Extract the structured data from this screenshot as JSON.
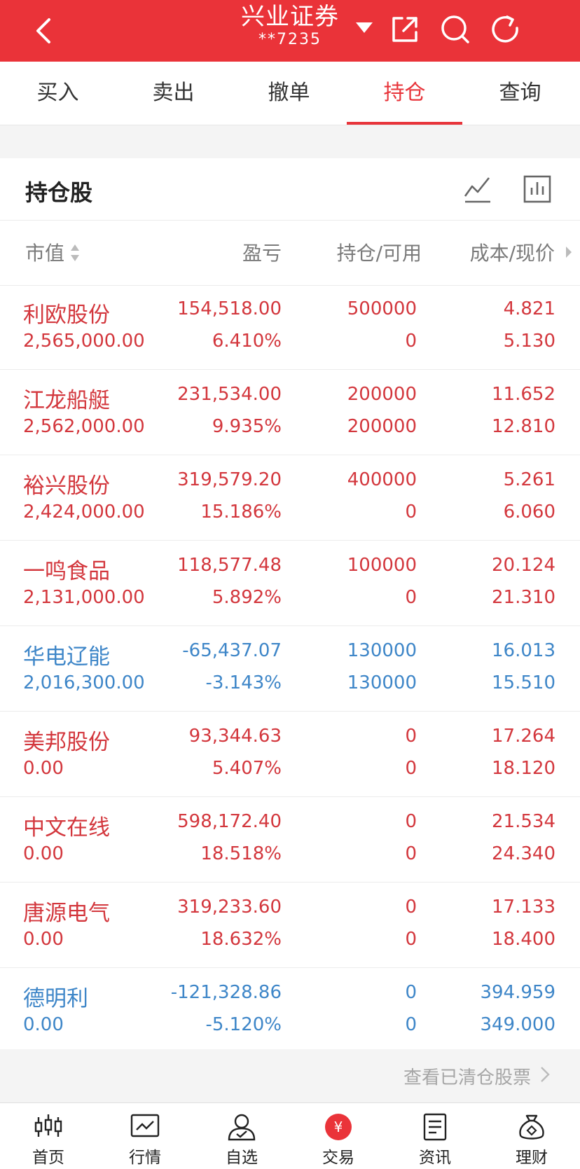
{
  "header": {
    "title": "兴业证券",
    "account": "**7235",
    "icons": [
      "back-icon",
      "dropdown-icon",
      "share-icon",
      "search-icon",
      "refresh-icon"
    ]
  },
  "tabs": [
    "买入",
    "卖出",
    "撤单",
    "持仓",
    "查询"
  ],
  "active_tab": "持仓",
  "section": {
    "title": "持仓股",
    "icons": [
      "line-chart-icon",
      "bar-chart-icon"
    ]
  },
  "columns": [
    "市值",
    "盈亏",
    "持仓/可用",
    "成本/现价"
  ],
  "holdings": [
    {
      "name": "利欧股份",
      "market_value": "2,565,000.00",
      "pl": "154,518.00",
      "pl_pct": "6.410%",
      "position": "500000",
      "available": "0",
      "cost": "4.821",
      "price": "5.130",
      "trend": "up"
    },
    {
      "name": "江龙船艇",
      "market_value": "2,562,000.00",
      "pl": "231,534.00",
      "pl_pct": "9.935%",
      "position": "200000",
      "available": "200000",
      "cost": "11.652",
      "price": "12.810",
      "trend": "up"
    },
    {
      "name": "裕兴股份",
      "market_value": "2,424,000.00",
      "pl": "319,579.20",
      "pl_pct": "15.186%",
      "position": "400000",
      "available": "0",
      "cost": "5.261",
      "price": "6.060",
      "trend": "up"
    },
    {
      "name": "一鸣食品",
      "market_value": "2,131,000.00",
      "pl": "118,577.48",
      "pl_pct": "5.892%",
      "position": "100000",
      "available": "0",
      "cost": "20.124",
      "price": "21.310",
      "trend": "up"
    },
    {
      "name": "华电辽能",
      "market_value": "2,016,300.00",
      "pl": "-65,437.07",
      "pl_pct": "-3.143%",
      "position": "130000",
      "available": "130000",
      "cost": "16.013",
      "price": "15.510",
      "trend": "down"
    },
    {
      "name": "美邦股份",
      "market_value": "0.00",
      "pl": "93,344.63",
      "pl_pct": "5.407%",
      "position": "0",
      "available": "0",
      "cost": "17.264",
      "price": "18.120",
      "trend": "up"
    },
    {
      "name": "中文在线",
      "market_value": "0.00",
      "pl": "598,172.40",
      "pl_pct": "18.518%",
      "position": "0",
      "available": "0",
      "cost": "21.534",
      "price": "24.340",
      "trend": "up"
    },
    {
      "name": "唐源电气",
      "market_value": "0.00",
      "pl": "319,233.60",
      "pl_pct": "18.632%",
      "position": "0",
      "available": "0",
      "cost": "17.133",
      "price": "18.400",
      "trend": "up"
    },
    {
      "name": "德明利",
      "market_value": "0.00",
      "pl": "-121,328.86",
      "pl_pct": "-5.120%",
      "position": "0",
      "available": "0",
      "cost": "394.959",
      "price": "349.000",
      "trend": "down"
    }
  ],
  "cleared_link": "查看已清仓股票",
  "bottom_nav": [
    "首页",
    "行情",
    "自选",
    "交易",
    "资讯",
    "理财"
  ],
  "colors": {
    "brand": "#ea3339",
    "up": "#d3373d",
    "down": "#3e86c8"
  }
}
